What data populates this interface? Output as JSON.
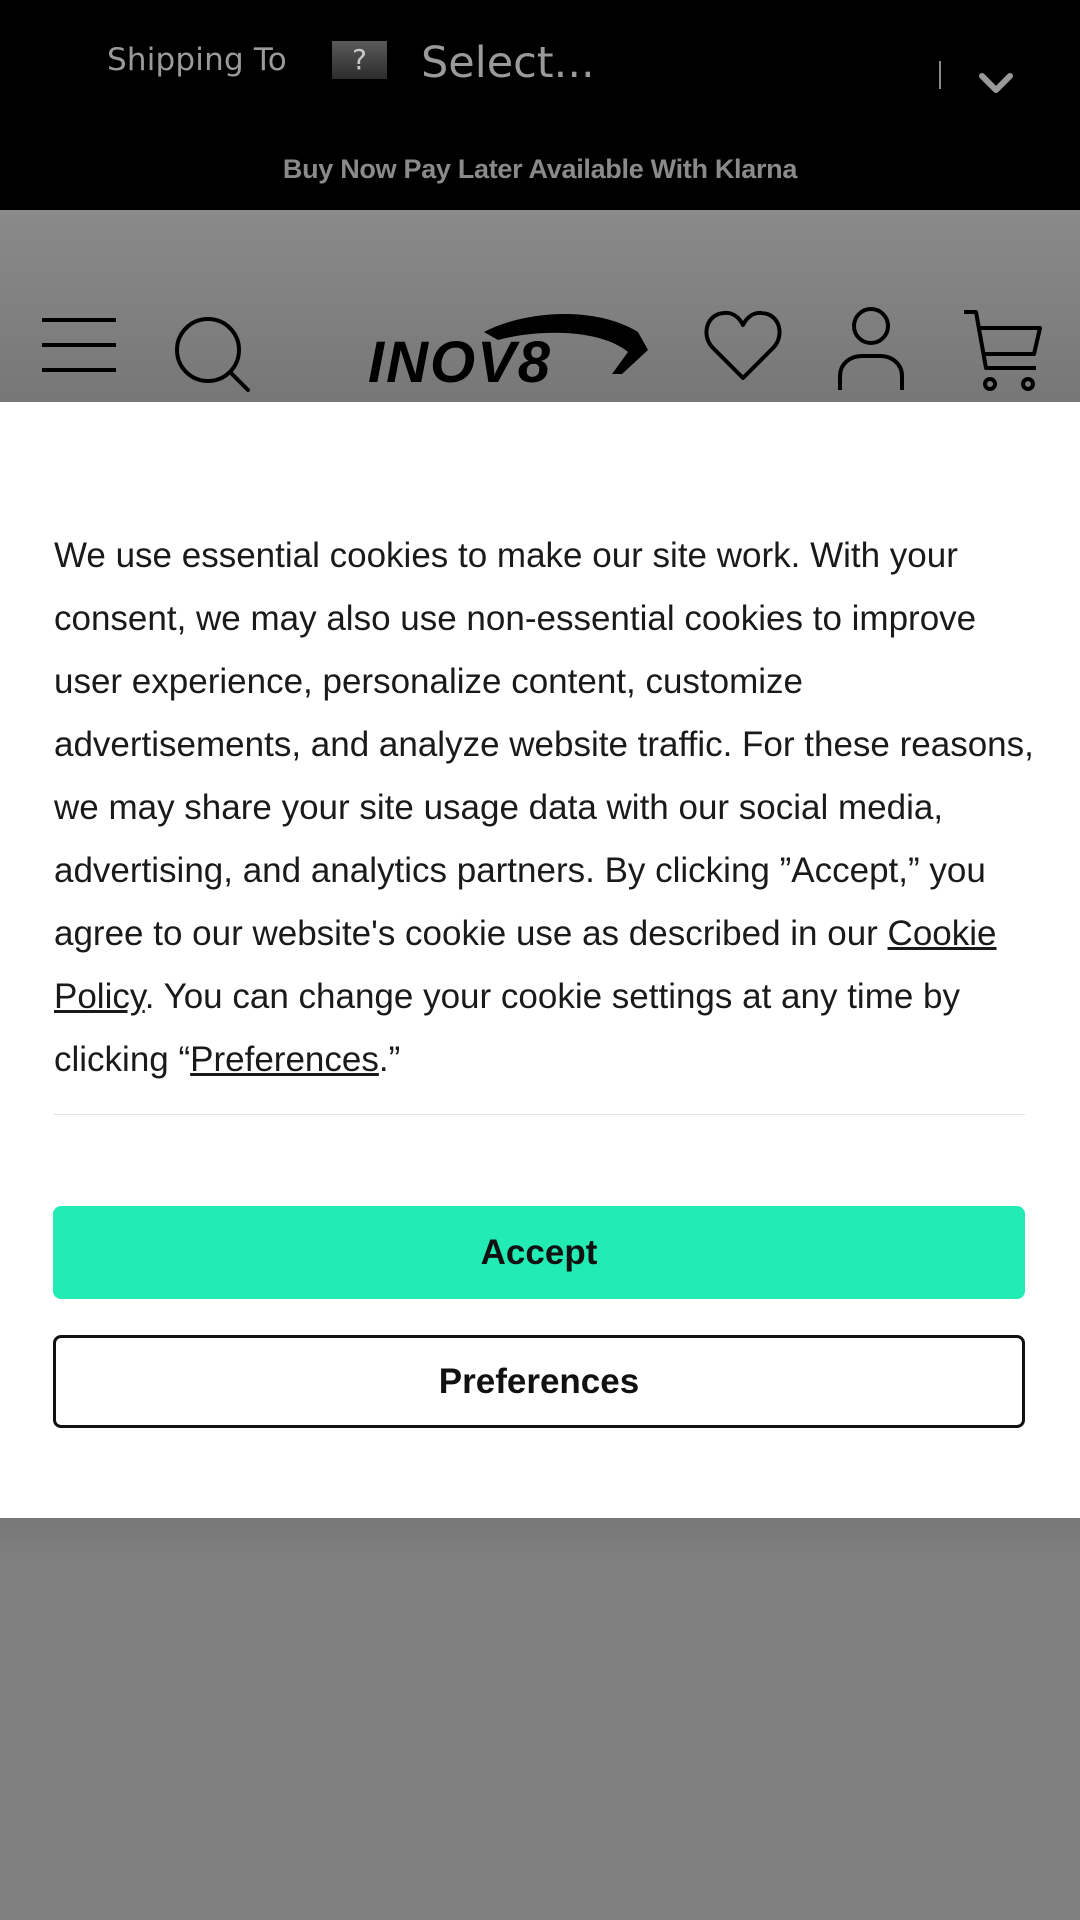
{
  "topbar": {
    "shipping_label": "Shipping To",
    "flag_placeholder": "?",
    "select_value": "Select...",
    "promo_text": "Buy Now Pay Later Available With Klarna"
  },
  "header": {
    "logo_text": "INOV8",
    "icons": [
      "menu-icon",
      "search-icon",
      "wishlist-heart-icon",
      "account-icon",
      "cart-icon"
    ]
  },
  "cookie_banner": {
    "text_part1": "We use essential cookies to make our site work. With your consent, we may also use non-essential cookies to improve user experience, personalize content, customize advertisements, and analyze website traffic. For these reasons, we may share your site usage data with our social media, advertising, and analytics partners. By clicking ”Accept,” you agree to our website's cookie use as described in our ",
    "cookie_policy_link": "Cookie Policy",
    "text_part2": ". You can change your cookie settings at any time by clicking “",
    "preferences_link": "Preferences",
    "text_part3": ".”",
    "accept_label": "Accept",
    "preferences_label": "Preferences"
  },
  "colors": {
    "accent": "#22ebb3",
    "topbar_bg": "#000000",
    "overlay_grey": "#808080"
  }
}
